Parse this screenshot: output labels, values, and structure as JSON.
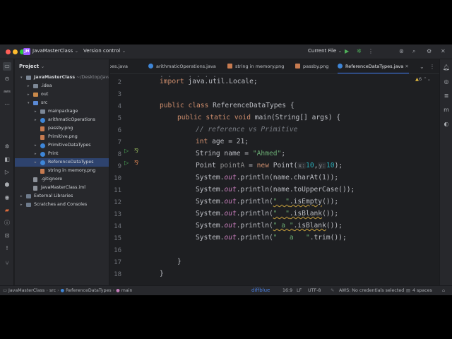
{
  "titlebar": {
    "project_badge": "JM",
    "project_name": "JavaMasterClass",
    "vcs_label": "Version control",
    "run_config": "Current File"
  },
  "project_panel": {
    "title": "Project",
    "tree": [
      {
        "label": "JavaMasterClass",
        "suffix": " ~/Desktop/JavaM",
        "depth": 0,
        "icon": "folder",
        "expanded": true
      },
      {
        "label": ".idea",
        "depth": 1,
        "icon": "folder",
        "expanded": false
      },
      {
        "label": "out",
        "depth": 1,
        "icon": "folder-orange",
        "expanded": false
      },
      {
        "label": "src",
        "depth": 1,
        "icon": "folder-blue",
        "expanded": true
      },
      {
        "label": "mainpackage",
        "depth": 2,
        "icon": "folder",
        "expanded": false
      },
      {
        "label": "arithmaticOperations",
        "depth": 2,
        "icon": "class",
        "expanded": false
      },
      {
        "label": "passby.png",
        "depth": 2,
        "icon": "png"
      },
      {
        "label": "Primitive.png",
        "depth": 2,
        "icon": "png"
      },
      {
        "label": "PrimitiveDataTypes",
        "depth": 2,
        "icon": "class",
        "expanded": false
      },
      {
        "label": "Print",
        "depth": 2,
        "icon": "class",
        "expanded": false
      },
      {
        "label": "ReferenceDataTypes",
        "depth": 2,
        "icon": "class",
        "expanded": false,
        "selected": true
      },
      {
        "label": "string in memory.png",
        "depth": 2,
        "icon": "png"
      },
      {
        "label": ".gitignore",
        "depth": 1,
        "icon": "file"
      },
      {
        "label": "JavaMasterClass.iml",
        "depth": 1,
        "icon": "file"
      },
      {
        "label": "External Libraries",
        "depth": 0,
        "icon": "lib",
        "expanded": false
      },
      {
        "label": "Scratches and Consoles",
        "depth": 0,
        "icon": "lib",
        "expanded": false
      }
    ]
  },
  "tabs": [
    {
      "label": "ypes.java",
      "icon": "class"
    },
    {
      "label": "arithmaticOperations.java",
      "icon": "class"
    },
    {
      "label": "string in memory.png",
      "icon": "png"
    },
    {
      "label": "passby.png",
      "icon": "png"
    },
    {
      "label": "ReferenceDataTypes.java",
      "icon": "class",
      "active": true
    }
  ],
  "editor": {
    "line_numbers": [
      "2",
      "3",
      "4",
      "5",
      "6",
      "7",
      "8",
      "9",
      "10",
      "11",
      "12",
      "13",
      "14",
      "15",
      "16",
      "17",
      "18"
    ],
    "inspection": "6",
    "code": {
      "l2_import": "import",
      "l2_rest": " java.util.Locale;",
      "l4_public": "public",
      "l4_class": "class",
      "l4_name": " ReferenceDataTypes {",
      "l5_mods": "public static void",
      "l5_rest": " main(String[] args) {",
      "l6_comment": "// reference vs Primitive",
      "l7_kw": "int",
      "l7_rest": " age = 21;",
      "l8_a": "String name = ",
      "l8_str": "\"Ahmed\"",
      "l8_b": ";",
      "l9_a": "Point ",
      "l9_var": "pointA",
      "l9_b": " = ",
      "l9_new": "new",
      "l9_c": " Point(",
      "l9_hx": "x:",
      "l9_vx": "10",
      "l9_d": ",",
      "l9_hy": "y:",
      "l9_vy": "10",
      "l9_e": ");",
      "sys": "System.",
      "out": "out",
      "l10_rest": ".println(name.charAt(1));",
      "l11_rest": ".println(name.toUpperCase());",
      "println_open": ".println(",
      "l12_str": "\"  \"",
      "l12_m": ".isEmpty",
      "l12_end": "());",
      "l13_str": "\"  \"",
      "l13_m": ".isBlank",
      "l13_end": "());",
      "l14_str": "\" a \"",
      "l14_m": ".isBlank",
      "l14_end": "());",
      "l15_str": "\"   a   \"",
      "l15_end": ".trim());",
      "l17": "}",
      "l18": "}"
    }
  },
  "statusbar": {
    "breadcrumbs": [
      "JavaMasterClass",
      "src",
      "ReferenceDataTypes",
      "main"
    ],
    "plugin": "diffblue",
    "position": "16:9",
    "line_sep": "LF",
    "encoding": "UTF-8",
    "aws": "AWS: No credentials selected",
    "indent": "4 spaces"
  }
}
